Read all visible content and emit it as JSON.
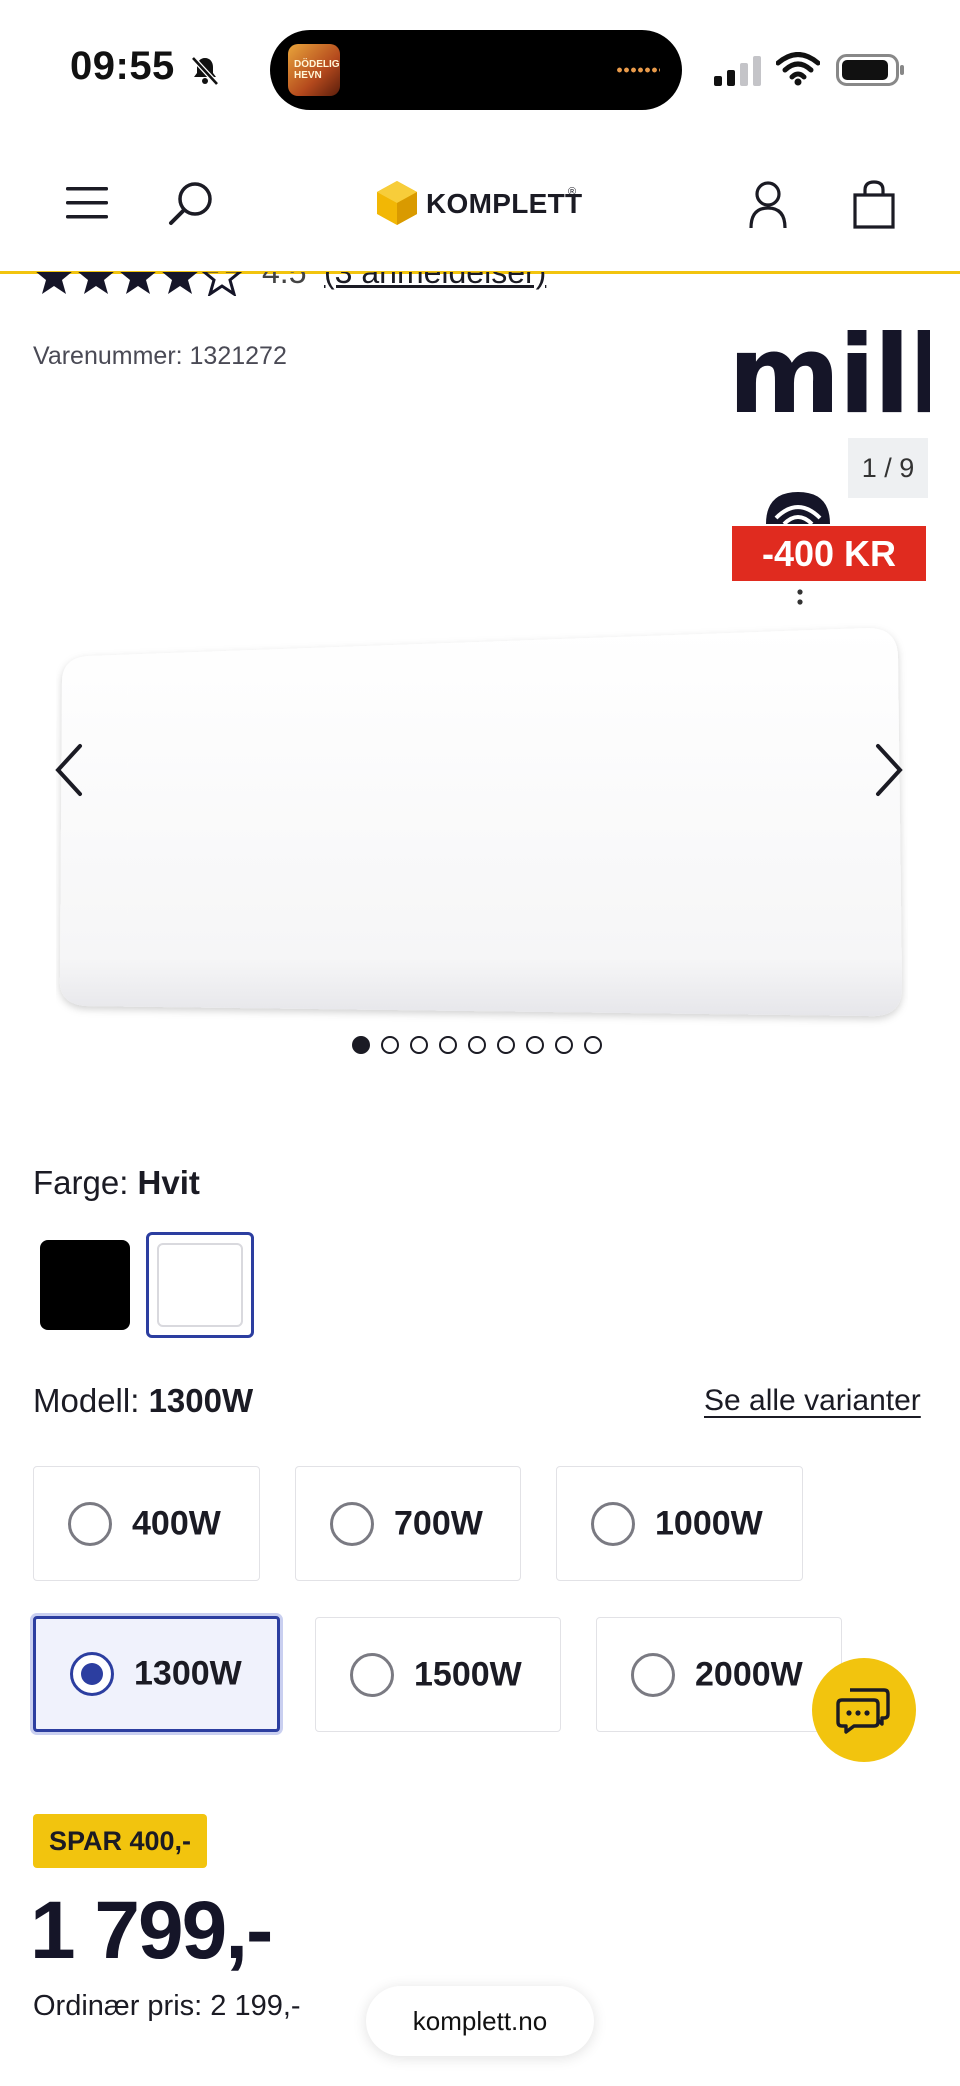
{
  "status_bar": {
    "time": "09:55",
    "island_thumb_text": "DÖDELIG HEVN"
  },
  "header": {
    "logo_text": "KOMPLETT",
    "brand_color": "#f2c40e"
  },
  "rating": {
    "value": "4.5",
    "stars": 4.5,
    "reviews": "(3 anmeldelser)"
  },
  "product": {
    "sku_label": "Varenummer: 1321272",
    "brand": "mill",
    "image_counter": "1 / 9",
    "discount_badge": "-400 KR",
    "discount_color": "#e02b1f"
  },
  "gallery": {
    "total_images": 9,
    "active_index": 0
  },
  "color": {
    "label": "Farge:",
    "selected": "Hvit",
    "swatches": [
      "black",
      "white"
    ],
    "selected_swatch": "white"
  },
  "model": {
    "label": "Modell:",
    "selected": "1300W",
    "see_all": "Se alle varianter",
    "options": [
      "400W",
      "700W",
      "1000W",
      "1300W",
      "1500W",
      "2000W"
    ]
  },
  "price": {
    "save_badge": "SPAR 400,-",
    "current": "1 799,-",
    "regular": "Ordinær pris: 2 199,-"
  },
  "browser": {
    "url": "komplett.no"
  },
  "icons": {
    "menu": "menu-icon",
    "search": "search-icon",
    "user": "user-icon",
    "cart": "shopping-bag-icon",
    "chat": "chat-icon",
    "prev": "chevron-left-icon",
    "next": "chevron-right-icon"
  }
}
